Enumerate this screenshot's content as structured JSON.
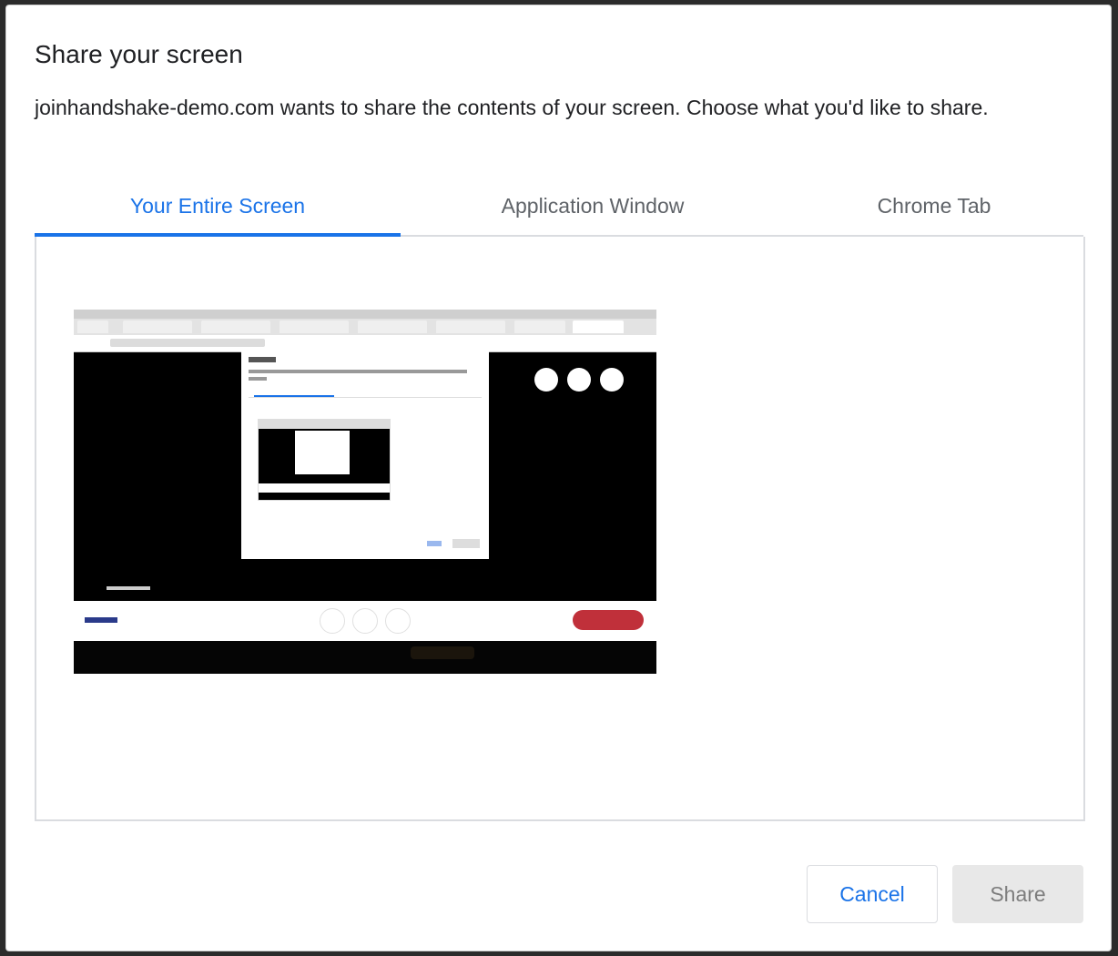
{
  "dialog": {
    "title": "Share your screen",
    "description": "joinhandshake-demo.com wants to share the contents of your screen. Choose what you'd like to share."
  },
  "tabs": [
    {
      "label": "Your Entire Screen",
      "active": true
    },
    {
      "label": "Application Window",
      "active": false
    },
    {
      "label": "Chrome Tab",
      "active": false
    }
  ],
  "panel": {
    "selected_item": "entire-screen-thumbnail"
  },
  "buttons": {
    "cancel_label": "Cancel",
    "share_label": "Share",
    "share_enabled": false
  },
  "colors": {
    "accent": "#1a73e8",
    "disabled_bg": "#e8e8e8",
    "disabled_text": "#7d7d7d"
  }
}
